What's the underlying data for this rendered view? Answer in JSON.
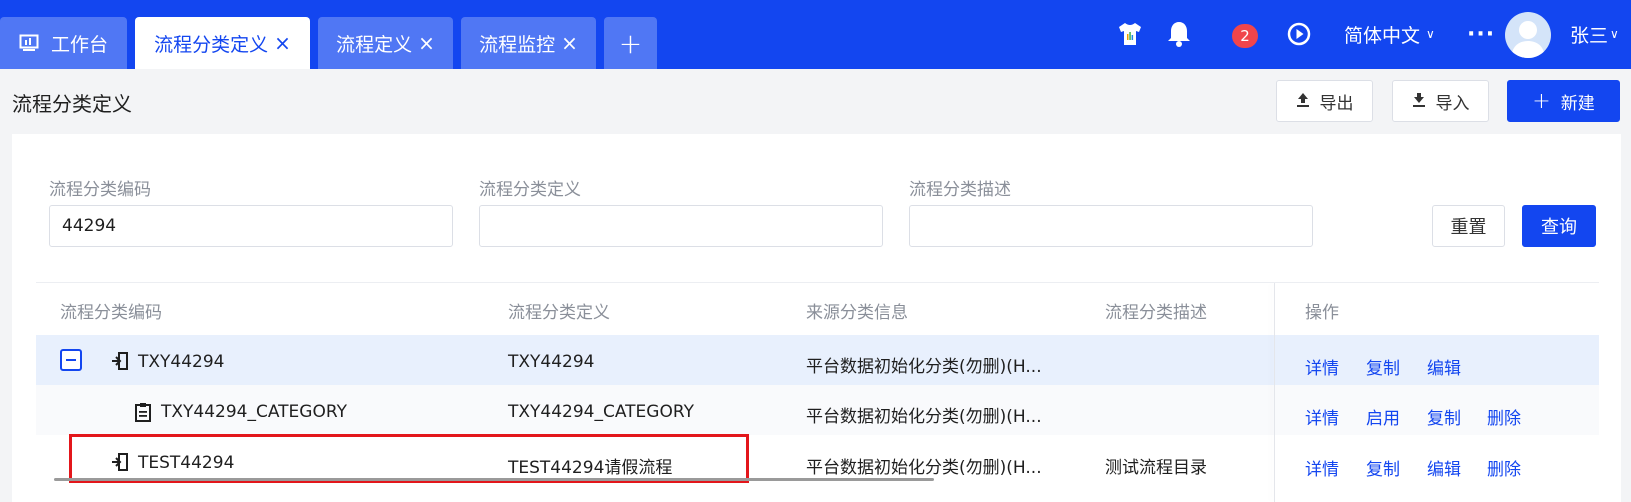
{
  "tabs": [
    {
      "label": "工作台",
      "icon": "monitor-icon",
      "active": false,
      "closable": false
    },
    {
      "label": "流程分类定义",
      "active": true,
      "closable": true
    },
    {
      "label": "流程定义",
      "active": false,
      "closable": true
    },
    {
      "label": "流程监控",
      "active": false,
      "closable": true
    }
  ],
  "tab_close_glyph": "×",
  "tab_add_glyph": "+",
  "header": {
    "notification_count": "2",
    "language": "简体中文",
    "more": "···",
    "user_name": "张三"
  },
  "page": {
    "title": "流程分类定义",
    "export_label": "导出",
    "import_label": "导入",
    "new_label": "新建"
  },
  "filters": {
    "code_label": "流程分类编码",
    "code_value": "44294",
    "def_label": "流程分类定义",
    "def_value": "",
    "desc_label": "流程分类描述",
    "desc_value": "",
    "reset_label": "重置",
    "query_label": "查询"
  },
  "table": {
    "columns": [
      "流程分类编码",
      "流程分类定义",
      "来源分类信息",
      "流程分类描述",
      "操作"
    ],
    "rows": [
      {
        "code": "TXY44294",
        "definition": "TXY44294",
        "source": "平台数据初始化分类(勿删)(H...",
        "description": "",
        "actions": [
          "详情",
          "复制",
          "编辑"
        ],
        "icon": "folder-export-icon"
      },
      {
        "code": "TXY44294_CATEGORY",
        "definition": "TXY44294_CATEGORY",
        "source": "平台数据初始化分类(勿删)(H...",
        "description": "",
        "actions": [
          "详情",
          "启用",
          "复制",
          "删除"
        ],
        "icon": "clipboard-icon"
      },
      {
        "code": "TEST44294",
        "definition": "TEST44294请假流程",
        "source": "平台数据初始化分类(勿删)(H...",
        "description": "测试流程目录",
        "actions": [
          "详情",
          "复制",
          "编辑",
          "删除"
        ],
        "icon": "folder-export-icon"
      }
    ]
  },
  "colors": {
    "primary": "#1346f0",
    "highlight_border": "#e3161b",
    "badge": "#f0454b",
    "row_selected": "#e8f0fd"
  }
}
